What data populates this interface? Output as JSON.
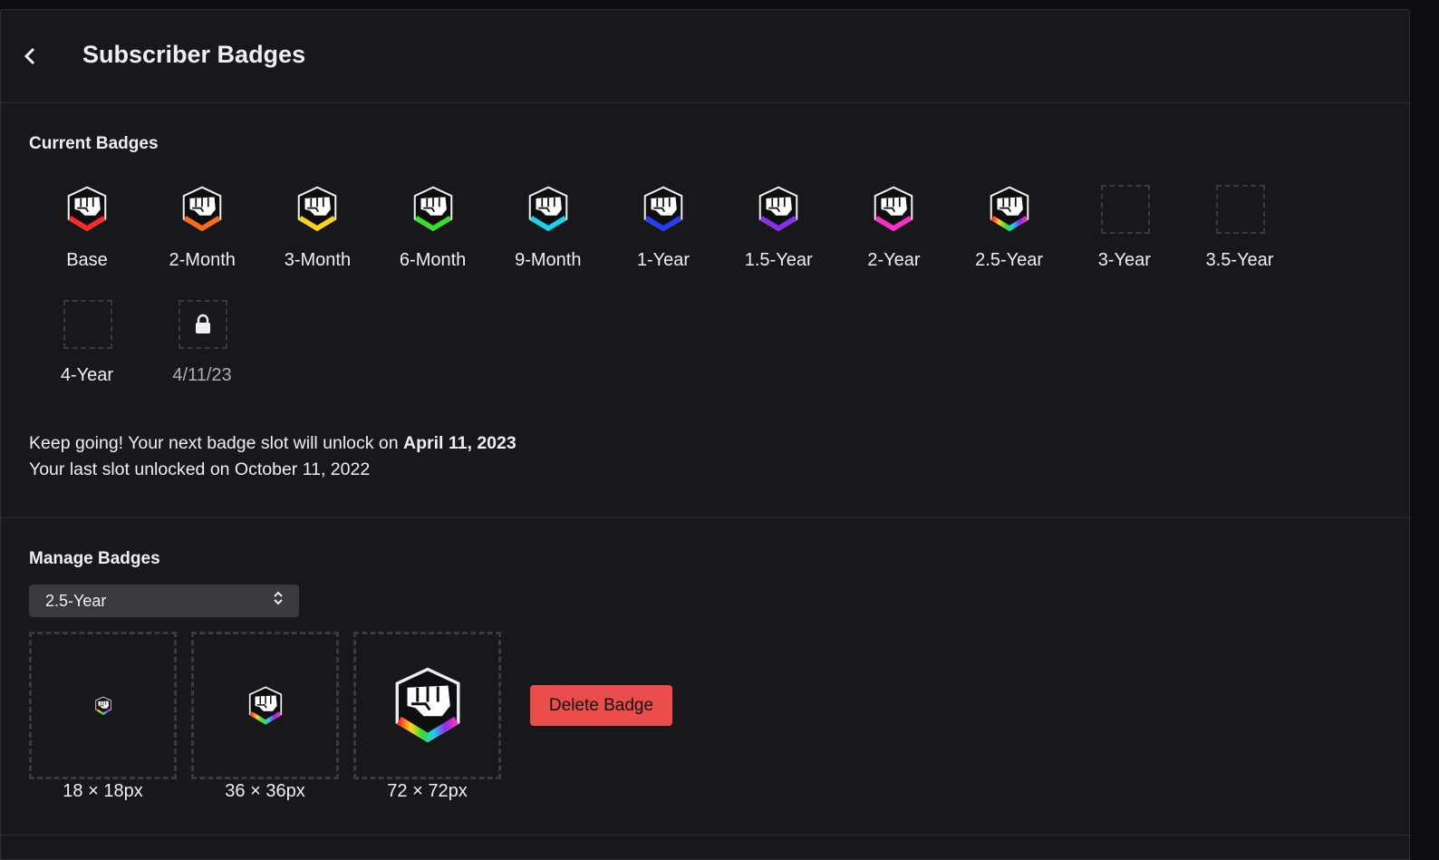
{
  "header": {
    "title": "Subscriber Badges",
    "back_icon": "chevron-left-icon"
  },
  "current": {
    "title": "Current Badges",
    "badges": [
      {
        "label": "Base",
        "color": "#ff2828",
        "filled": true
      },
      {
        "label": "2-Month",
        "color": "#ff6a1a",
        "filled": true
      },
      {
        "label": "3-Month",
        "color": "#ffd21a",
        "filled": true
      },
      {
        "label": "6-Month",
        "color": "#3adf2a",
        "filled": true
      },
      {
        "label": "9-Month",
        "color": "#18d2ee",
        "filled": true
      },
      {
        "label": "1-Year",
        "color": "#1f3dff",
        "filled": true
      },
      {
        "label": "1.5-Year",
        "color": "#8b2cf0",
        "filled": true
      },
      {
        "label": "2-Year",
        "color": "#ff2bc8",
        "filled": true
      },
      {
        "label": "2.5-Year",
        "color": "rainbow",
        "filled": true
      },
      {
        "label": "3-Year",
        "filled": false
      },
      {
        "label": "3.5-Year",
        "filled": false
      },
      {
        "label": "4-Year",
        "filled": false
      },
      {
        "label": "4/11/23",
        "filled": false,
        "locked": true
      }
    ],
    "info_line1_prefix": "Keep going! Your next badge slot will unlock on ",
    "info_line1_date": "April 11, 2023",
    "info_line2": "Your last slot unlocked on October 11, 2022"
  },
  "manage": {
    "title": "Manage Badges",
    "selected": "2.5-Year",
    "previews": [
      {
        "size_label": "18 × 18px"
      },
      {
        "size_label": "36 × 36px"
      },
      {
        "size_label": "72 × 72px"
      }
    ],
    "delete_label": "Delete Badge"
  },
  "colors": {
    "danger": "#eb4d4b",
    "panel": "#18181b",
    "background": "#0e0e10"
  }
}
